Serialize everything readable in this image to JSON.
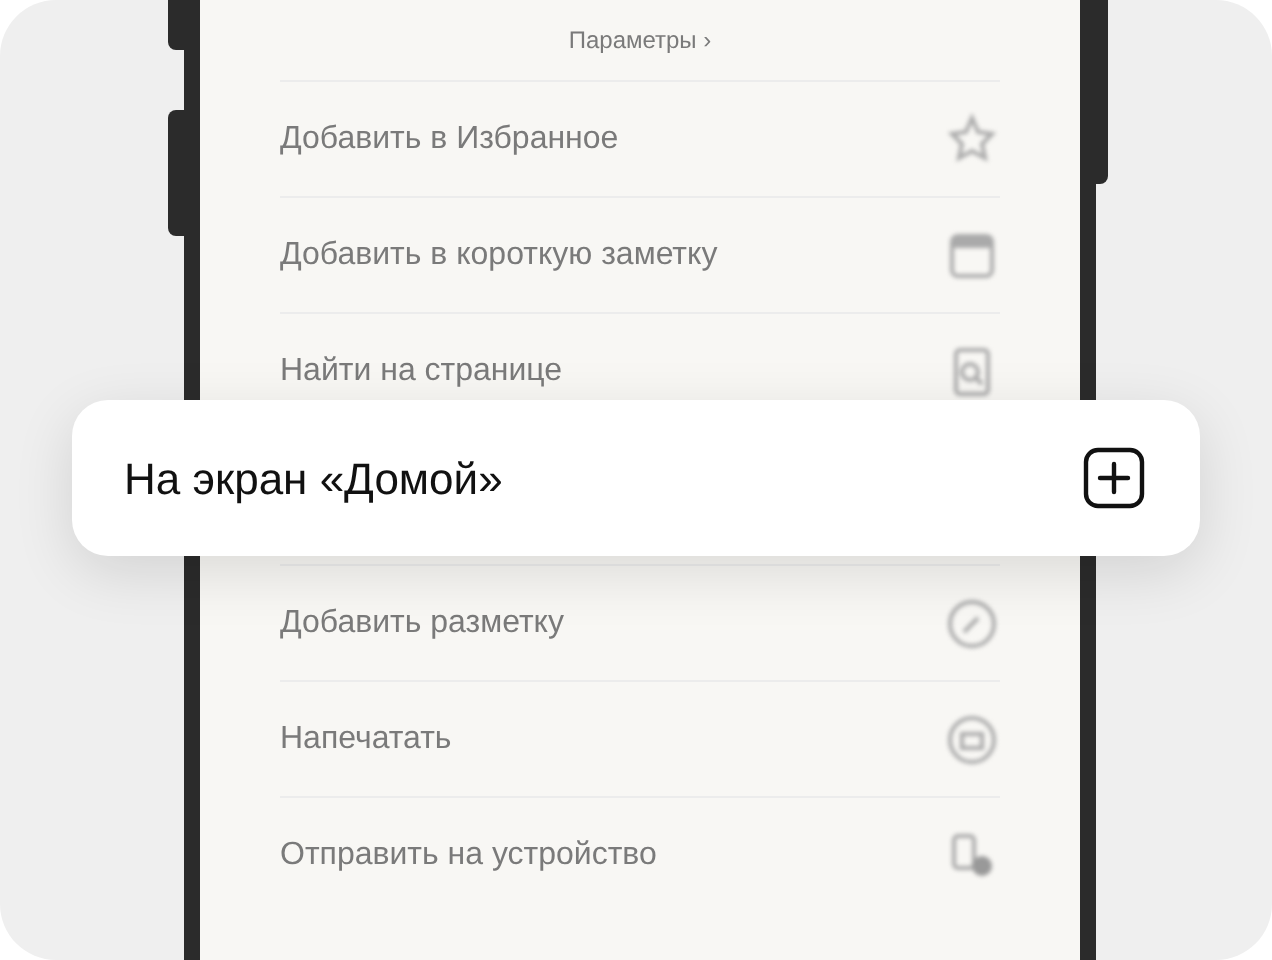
{
  "menu": {
    "header": "Параметры ›",
    "items": [
      {
        "label": "Добавить в Избранное",
        "kind": "star"
      },
      {
        "label": "Добавить в короткую заметку",
        "kind": "note"
      },
      {
        "label": "Найти на странице",
        "kind": "find"
      },
      {
        "label": "Добавить разметку",
        "kind": "markup"
      },
      {
        "label": "Напечатать",
        "kind": "print"
      },
      {
        "label": "Отправить на устройство",
        "kind": "device"
      }
    ]
  },
  "popup": {
    "label": "На экран «Домой»"
  }
}
